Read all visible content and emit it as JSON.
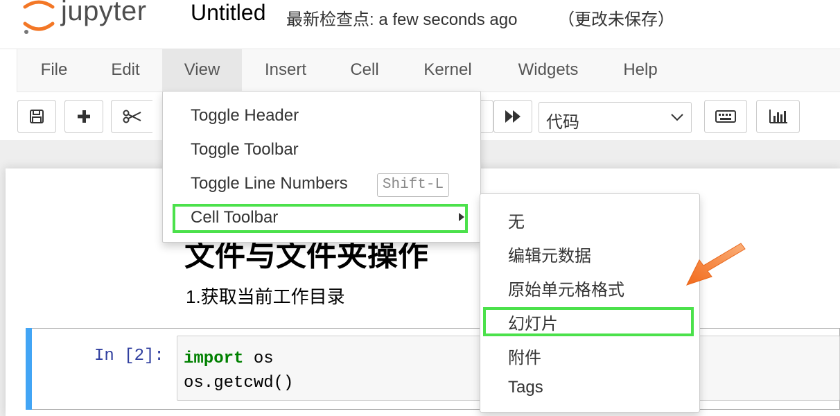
{
  "header": {
    "logo_text": "jupyter",
    "notebook_name": "Untitled",
    "checkpoint": "最新检查点: a few seconds ago",
    "save_status": "（更改未保存）"
  },
  "menubar": {
    "items": [
      "File",
      "Edit",
      "View",
      "Insert",
      "Cell",
      "Kernel",
      "Widgets",
      "Help"
    ],
    "active": "View"
  },
  "toolbar": {
    "cell_type": "代码",
    "icons": [
      "save-icon",
      "plus-icon",
      "scissors-icon",
      "fast-forward-icon",
      "chevron-down-icon",
      "keyboard-icon",
      "bar-chart-icon"
    ]
  },
  "view_menu": {
    "items": [
      "Toggle Header",
      "Toggle Toolbar",
      "Toggle Line Numbers",
      "Cell Toolbar"
    ],
    "shortcut": "Shift-L"
  },
  "cell_toolbar_submenu": {
    "items": [
      "无",
      "编辑元数据",
      "原始单元格格式",
      "幻灯片",
      "附件",
      "Tags"
    ],
    "highlighted": "幻灯片"
  },
  "notebook": {
    "heading": "文件与文件夹操作",
    "markdown_text": "1.获取当前工作目录",
    "prompt": "In [2]:",
    "code_keyword": "import",
    "code_line1_rest": " os",
    "code_line2": "os.getcwd()"
  },
  "colors": {
    "highlight_box": "#4be14b",
    "annotation_arrow": "#f57c20",
    "cell_selected_bar": "#42a5f5",
    "prompt": "#303f9f"
  }
}
